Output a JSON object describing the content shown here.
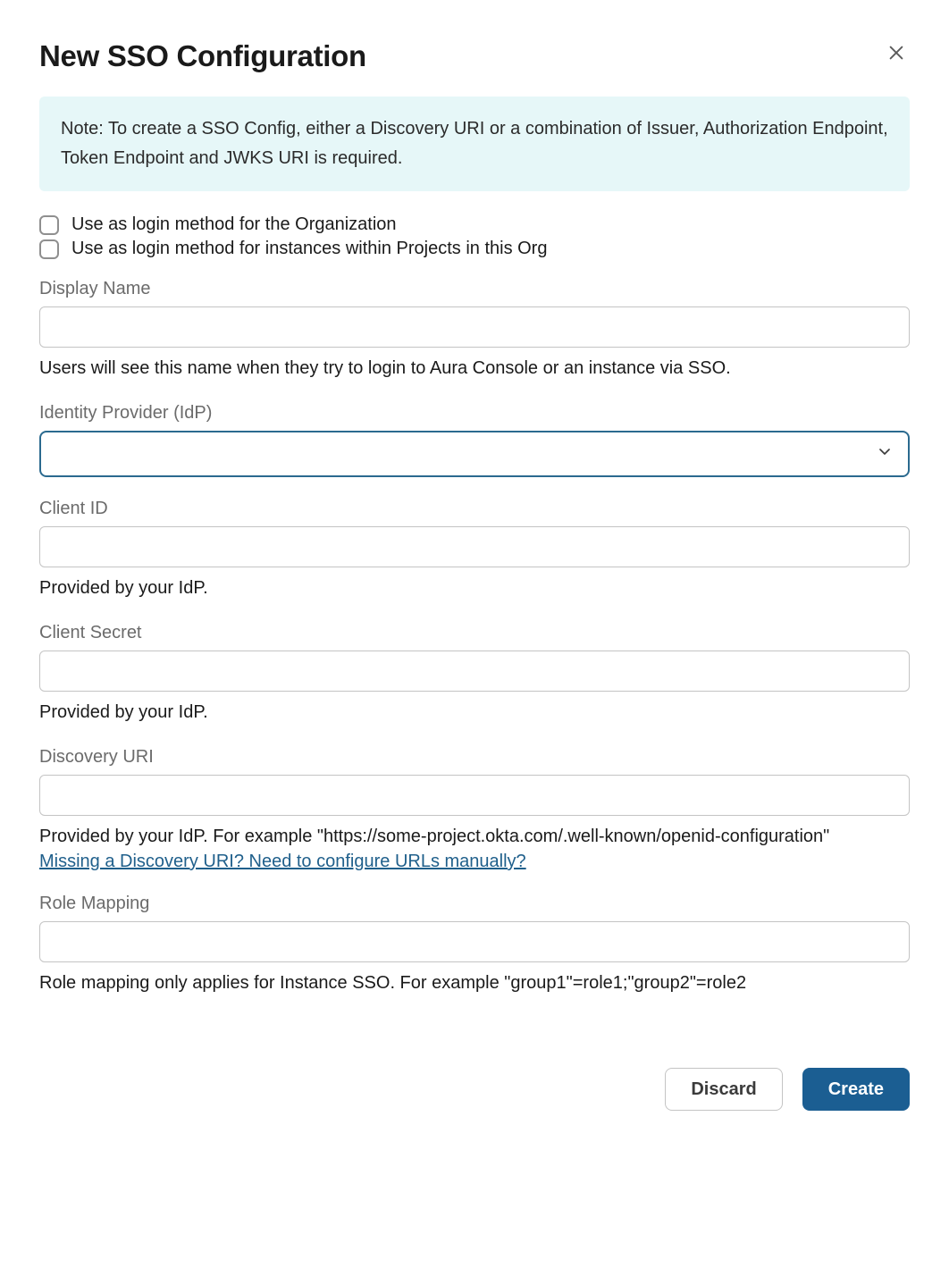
{
  "dialog": {
    "title": "New SSO Configuration",
    "note": "Note: To create a SSO Config, either a Discovery URI or a combination of Issuer, Authorization Endpoint, Token Endpoint and JWKS URI is required.",
    "checkboxes": {
      "org_login": "Use as login method for the Organization",
      "project_login": "Use as login method for instances within Projects in this Org"
    },
    "fields": {
      "display_name": {
        "label": "Display Name",
        "value": "",
        "help": "Users will see this name when they try to login to Aura Console or an instance via SSO."
      },
      "idp": {
        "label": "Identity Provider (IdP)",
        "value": ""
      },
      "client_id": {
        "label": "Client ID",
        "value": "",
        "help": "Provided by your IdP."
      },
      "client_secret": {
        "label": "Client Secret",
        "value": "",
        "help": "Provided by your IdP."
      },
      "discovery_uri": {
        "label": "Discovery URI",
        "value": "",
        "help": "Provided by your IdP. For example \"https://some-project.okta.com/.well-known/openid-configuration\"",
        "link": "Missing a Discovery URI? Need to configure URLs manually?"
      },
      "role_mapping": {
        "label": "Role Mapping",
        "value": "",
        "help": "Role mapping only applies for Instance SSO. For example \"group1\"=role1;\"group2\"=role2"
      }
    },
    "buttons": {
      "discard": "Discard",
      "create": "Create"
    }
  }
}
